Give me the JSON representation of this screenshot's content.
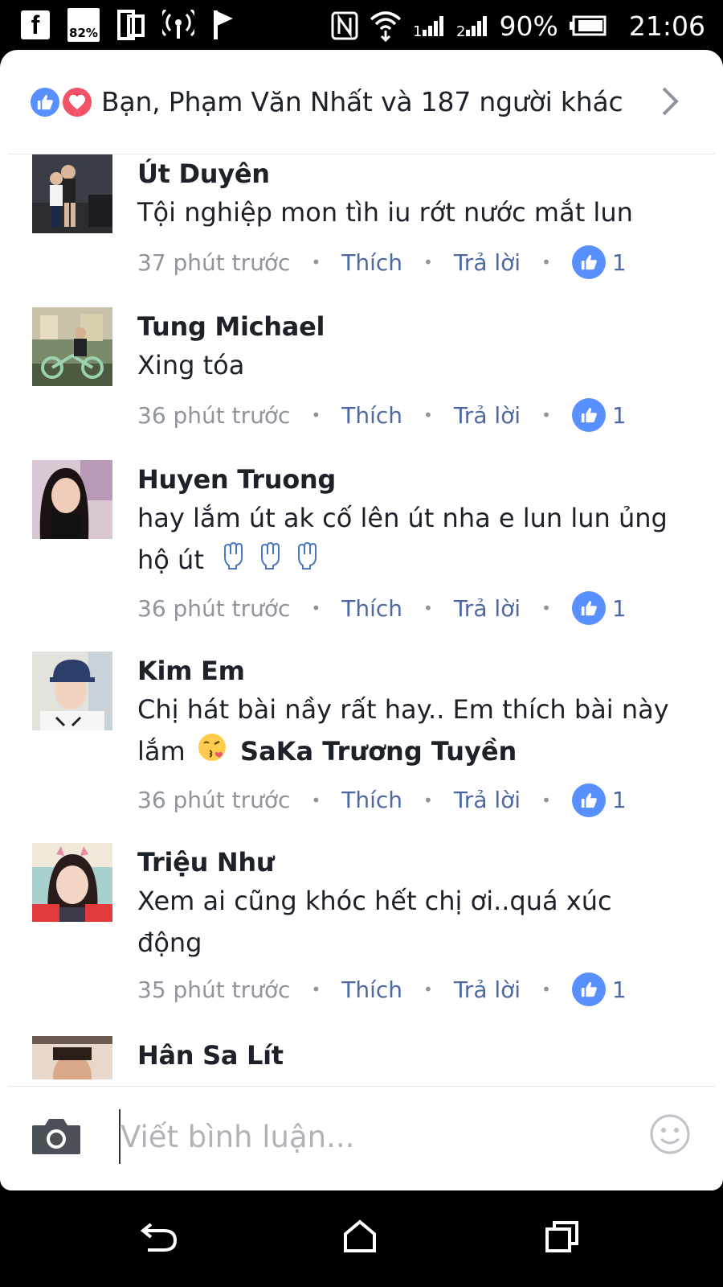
{
  "status_bar": {
    "left_icons": [
      "facebook-icon",
      "battery-saver-icon",
      "dual-screen-icon",
      "hotspot-icon",
      "flag-app-icon"
    ],
    "battery_saver_label": "82%",
    "battery_percent": "90%",
    "time": "21:06",
    "right_icons": [
      "nfc-icon",
      "wifi-icon",
      "signal-1-icon",
      "signal-2-icon",
      "battery-icon"
    ],
    "signal_1_label": "1",
    "signal_2_label": "2"
  },
  "reactions": {
    "summary": "Bạn, Phạm Văn Nhất và 187 người khác",
    "icons": [
      "like-icon",
      "love-icon"
    ],
    "chevron": "chevron-right-icon"
  },
  "comments": [
    {
      "name": "Út Duyên",
      "text": "Tội nghiệp mon tìh iu rớt nước mắt lun",
      "time": "37 phút trước",
      "like_label": "Thích",
      "reply_label": "Trả lời",
      "like_count": "1"
    },
    {
      "name": "Tung Michael",
      "text": "Xing tóa",
      "time": "36 phút trước",
      "like_label": "Thích",
      "reply_label": "Trả lời",
      "like_count": "1"
    },
    {
      "name": "Huyen Truong",
      "text_line1": "hay lắm út ak  cố lên út nha e lun lun  ủng",
      "text_line2": "hộ út",
      "emoji": [
        "raised-fist-icon",
        "raised-fist-icon",
        "raised-fist-icon"
      ],
      "time": "36 phút trước",
      "like_label": "Thích",
      "reply_label": "Trả lời",
      "like_count": "1"
    },
    {
      "name": "Kim Em",
      "text_line1": "Chị hát bài nầy rất hay.. Em thích bài này",
      "text_line2": "lắm",
      "emoji": [
        "kissing-face-icon"
      ],
      "mention": "SaKa Trương Tuyền",
      "time": "36 phút trước",
      "like_label": "Thích",
      "reply_label": "Trả lời",
      "like_count": "1"
    },
    {
      "name": "Triệu Như",
      "text_line1": "Xem ai cũng khóc hết chị ơi..quá xúc",
      "text_line2": "động",
      "time": "35 phút trước",
      "like_label": "Thích",
      "reply_label": "Trả lời",
      "like_count": "1"
    },
    {
      "name": "Hân Sa Lít"
    }
  ],
  "composer": {
    "placeholder": "Viết bình luận...",
    "camera_icon": "camera-icon",
    "emoji_icon": "smiley-icon"
  },
  "nav_bar": {
    "buttons": [
      "back-icon",
      "home-icon",
      "recents-icon"
    ]
  },
  "colors": {
    "facebook_blue": "#5890ff",
    "love_red": "#f25268",
    "link_blue": "#4e69a2",
    "meta_gray": "#90949c"
  }
}
